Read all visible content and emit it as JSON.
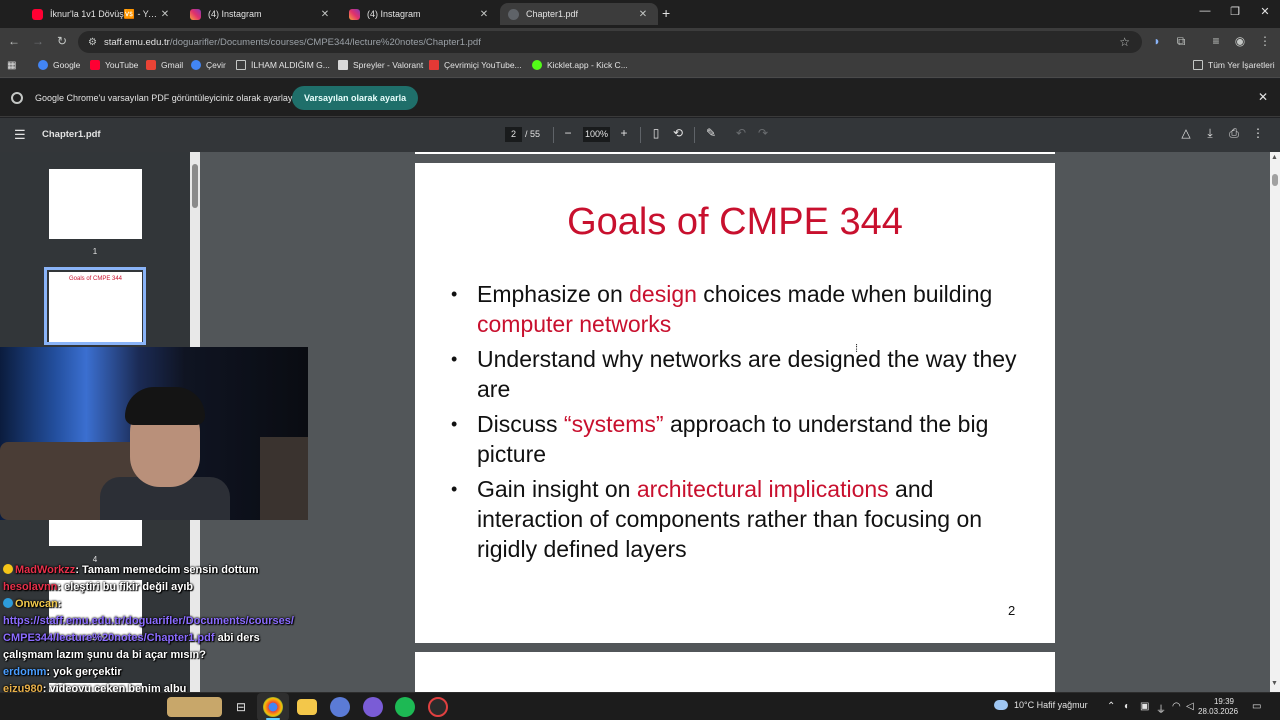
{
  "tabs": [
    {
      "title": "İknur'la 1v1 Dövüş🆚 - YouTube",
      "favicon": "youtube-icon"
    },
    {
      "title": "(4) Instagram",
      "favicon": "instagram-icon"
    },
    {
      "title": "(4) Instagram",
      "favicon": "instagram-icon"
    },
    {
      "title": "Chapter1.pdf",
      "favicon": "pdf-icon",
      "active": true
    }
  ],
  "address": {
    "host": "staff.emu.edu.tr",
    "path": "/doguarifler/Documents/courses/CMPE344/lecture%20notes/Chapter1.pdf"
  },
  "bookmarks": [
    {
      "label": "Google",
      "color": "#4285f4"
    },
    {
      "label": "YouTube",
      "color": "#ff0033"
    },
    {
      "label": "Gmail",
      "color": "#ea4335"
    },
    {
      "label": "Çevir",
      "color": "#4285f4"
    },
    {
      "label": "İLHAM ALDIĞIM G...",
      "color": "#c4c7c5"
    },
    {
      "label": "Spreyler - Valorant",
      "color": "#d8d8d8"
    },
    {
      "label": "Çevrimiçi YouTube...",
      "color": "#e53935"
    },
    {
      "label": "Kicklet.app - Kick C...",
      "color": "#53fc18"
    }
  ],
  "bookmarks_all": "Tüm Yer İşaretleri",
  "infobar": {
    "message": "Google Chrome'u varsayılan PDF görüntüleyiciniz olarak ayarlayın",
    "button": "Varsayılan olarak ayarla"
  },
  "pdf": {
    "filename": "Chapter1.pdf",
    "page": "2",
    "total": "/ 55",
    "zoom": "100%"
  },
  "thumbnails": [
    {
      "number": "1"
    },
    {
      "number": "4"
    }
  ],
  "slide": {
    "title": "Goals of CMPE 344",
    "bullets": [
      {
        "parts": [
          {
            "t": "Emphasize on ",
            "red": false
          },
          {
            "t": "design",
            "red": true
          },
          {
            "t": " choices made when building ",
            "red": false
          },
          {
            "t": "computer networks",
            "red": true
          }
        ]
      },
      {
        "parts": [
          {
            "t": "Understand why networks are designed the way they are",
            "red": false
          }
        ]
      },
      {
        "parts": [
          {
            "t": "Discuss ",
            "red": false
          },
          {
            "t": "“systems”",
            "red": true
          },
          {
            "t": " approach to understand the big picture",
            "red": false
          }
        ]
      },
      {
        "parts": [
          {
            "t": "Gain insight on ",
            "red": false
          },
          {
            "t": "architectural implications",
            "red": true
          },
          {
            "t": " and interaction of components rather than focusing on rigidly defined layers",
            "red": false
          }
        ]
      }
    ],
    "page_number": "2"
  },
  "chat": [
    {
      "user": "MadWorkzz",
      "user_color": "#e8304a",
      "badge": "#f5c518",
      "text": ": Tamam memedcim sensin dottum"
    },
    {
      "user": "hesolavnn",
      "user_color": "#e8304a",
      "badge": "",
      "text": ": eleştiri bu fikir değil ayıb"
    },
    {
      "user": "Onwcan",
      "user_color": "#f2c94c",
      "badge": "#2d9cdb",
      "text": ":"
    },
    {
      "user": "",
      "user_color": "#8b6cff",
      "badge": "",
      "text": "https://staff.emu.edu.tr/doguarifler/Documents/courses/"
    },
    {
      "user": "",
      "user_color": "#8b6cff",
      "badge": "",
      "text": "CMPE344/lecture%20notes/Chapter1.pdf",
      "suffix": " abi ders"
    },
    {
      "user": "",
      "user_color": "#ffffff",
      "badge": "",
      "text": "çalışmam lazım şunu da bi açar mısın?"
    },
    {
      "user": "erdomm",
      "user_color": "#4a9eff",
      "badge": "",
      "text": ": yok gerçektir"
    },
    {
      "user": "eizu980",
      "user_color": "#e8b04a",
      "badge": "",
      "text": ": videoyu çeken benim albu"
    }
  ],
  "taskbar": {
    "weather": "10°C  Hafif yağmur",
    "time": "19:39",
    "date": "28.03.2026"
  }
}
